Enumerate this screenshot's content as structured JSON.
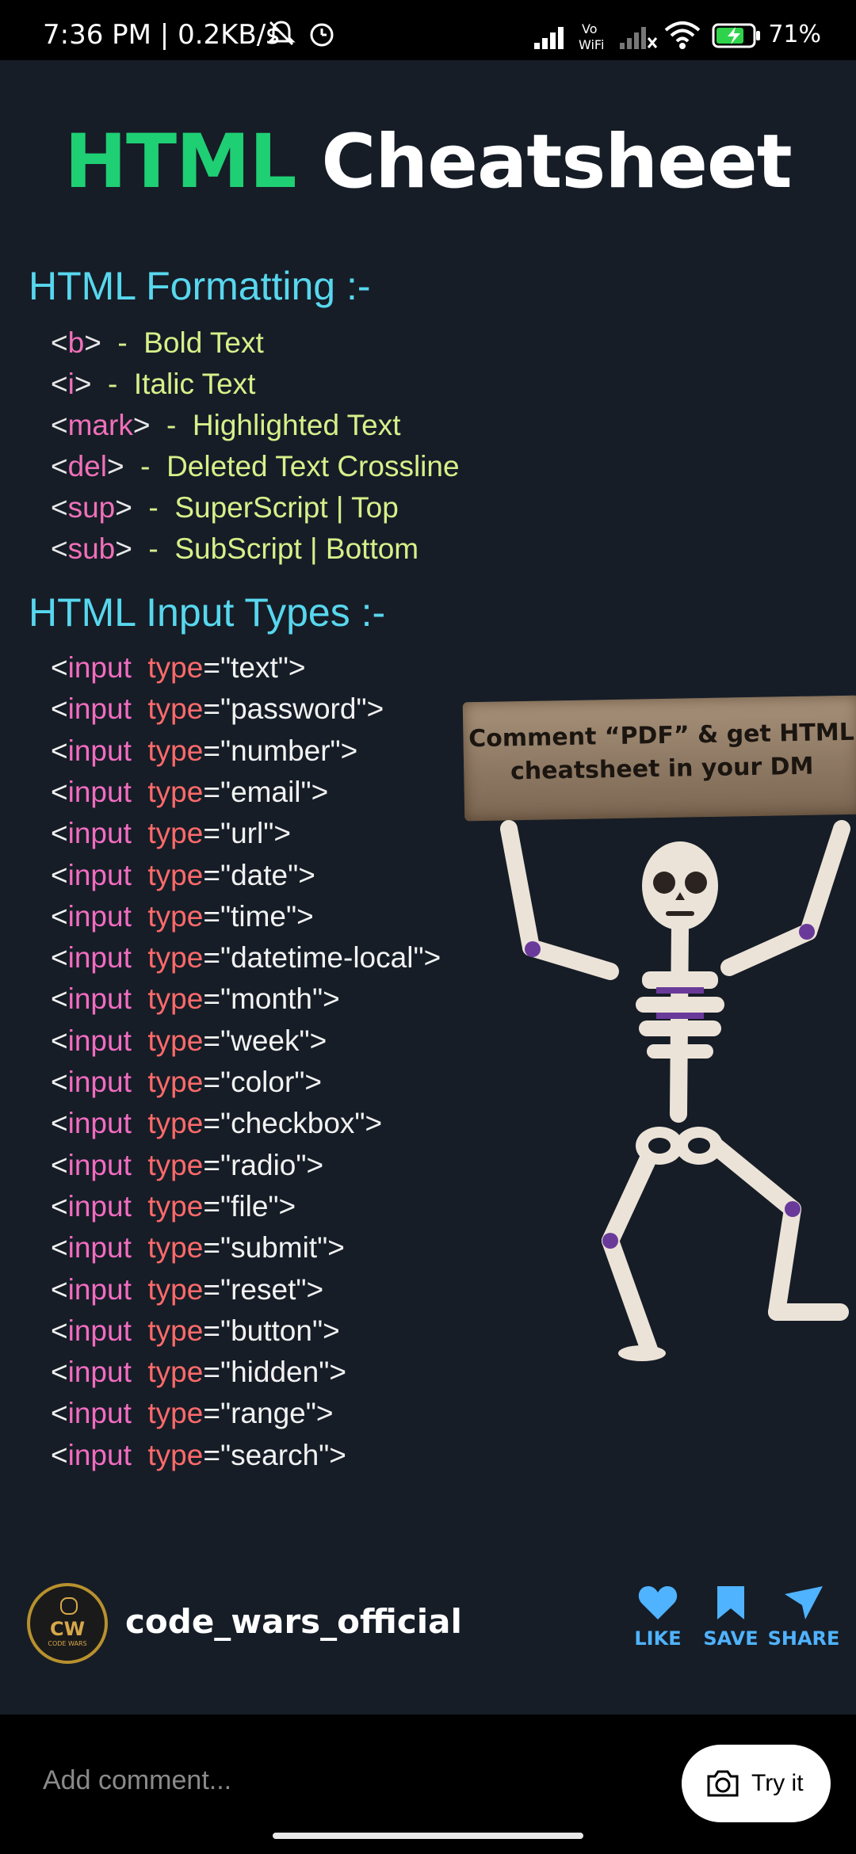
{
  "status_bar": {
    "time": "7:36 PM | 0.2KB/s",
    "battery_pct": "71%",
    "icons": [
      "mute-bell-icon",
      "alarm-icon",
      "signal-icon",
      "vowifi-icon",
      "signal-2-icon",
      "wifi-icon",
      "battery-charging-icon"
    ]
  },
  "post": {
    "title_part1": "HTML",
    "title_part2": "Cheatsheet",
    "formatting_heading": "HTML Formatting :-",
    "formatting": [
      {
        "open": "<",
        "tag": "b",
        "close": ">",
        "desc": "Bold Text"
      },
      {
        "open": "<",
        "tag": "i",
        "close": ">",
        "desc": "Italic Text"
      },
      {
        "open": "<",
        "tag": "mark",
        "close": ">",
        "desc": "Highlighted Text"
      },
      {
        "open": "<",
        "tag": "del",
        "close": ">",
        "desc": "Deleted Text Crossline"
      },
      {
        "open": "<",
        "tag": "sup",
        "close": ">",
        "desc": "SuperScript | Top"
      },
      {
        "open": "<",
        "tag": "sub",
        "close": ">",
        "desc": "SubScript | Bottom"
      }
    ],
    "input_heading": "HTML Input Types :-",
    "input_types": [
      "text",
      "password",
      "number",
      "email",
      "url",
      "date",
      "time",
      "datetime-local",
      "month",
      "week",
      "color",
      "checkbox",
      "radio",
      "file",
      "submit",
      "reset",
      "button",
      "hidden",
      "range",
      "search"
    ],
    "sign_text_line1": "Comment “PDF” & get HTML",
    "sign_text_line2": "cheatsheet in your DM"
  },
  "footer": {
    "avatar_text": "CW",
    "avatar_small": "CODE WARS",
    "username": "code_wars_official",
    "like_label": "LIKE",
    "save_label": "SAVE",
    "share_label": "SHARE",
    "accent_color": "#4fb3ff"
  },
  "bottom_bar": {
    "comment_placeholder": "Add comment...",
    "try_label": "Try it"
  }
}
